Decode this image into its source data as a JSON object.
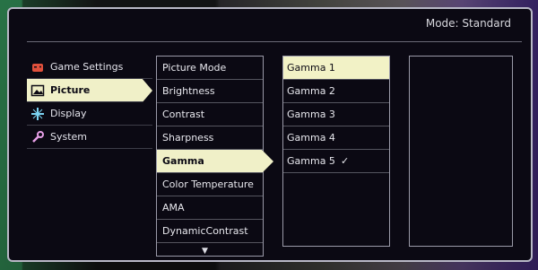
{
  "header": {
    "mode_label": "Mode: Standard"
  },
  "categories": [
    {
      "label": "Game Settings",
      "icon": "gamepad-icon",
      "selected": false
    },
    {
      "label": "Picture",
      "icon": "picture-icon",
      "selected": true
    },
    {
      "label": "Display",
      "icon": "display-icon",
      "selected": false
    },
    {
      "label": "System",
      "icon": "wrench-icon",
      "selected": false
    }
  ],
  "submenu": {
    "items": [
      {
        "label": "Picture Mode",
        "selected": false
      },
      {
        "label": "Brightness",
        "selected": false
      },
      {
        "label": "Contrast",
        "selected": false
      },
      {
        "label": "Sharpness",
        "selected": false
      },
      {
        "label": "Gamma",
        "selected": true
      },
      {
        "label": "Color Temperature",
        "selected": false
      },
      {
        "label": "AMA",
        "selected": false
      },
      {
        "label": "DynamicContrast",
        "selected": false
      }
    ],
    "more_indicator": "▼"
  },
  "options": {
    "items": [
      {
        "label": "Gamma 1",
        "highlighted": true,
        "checked": false
      },
      {
        "label": "Gamma 2",
        "highlighted": false,
        "checked": false
      },
      {
        "label": "Gamma 3",
        "highlighted": false,
        "checked": false
      },
      {
        "label": "Gamma 4",
        "highlighted": false,
        "checked": false
      },
      {
        "label": "Gamma 5",
        "highlighted": false,
        "checked": true
      }
    ],
    "check_mark": "✓"
  },
  "colors": {
    "selection": "#f0f0c8",
    "panel": "#0b0913",
    "frame": "#b8b8c6"
  }
}
